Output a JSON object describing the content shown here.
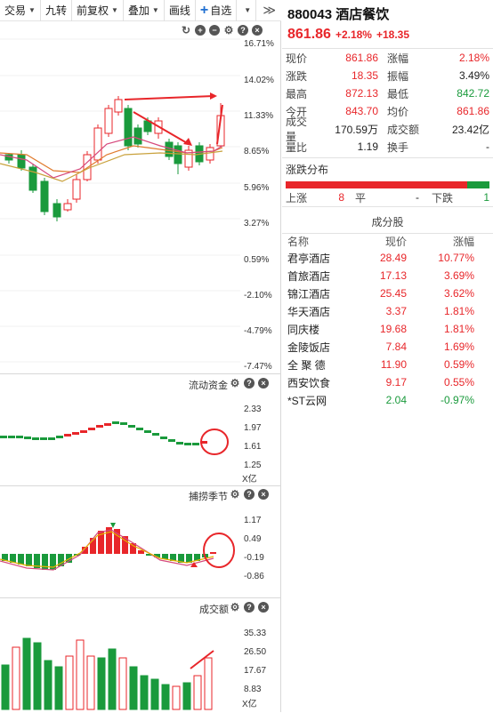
{
  "toolbar": {
    "trade": "交易",
    "nine_turn": "九转",
    "adjust": "前复权",
    "overlay": "叠加",
    "draw": "画线",
    "watchlist": "自选",
    "more": "≫"
  },
  "main_chart": {
    "price_labels": [
      "16.71%",
      "14.02%",
      "11.33%",
      "8.65%",
      "5.96%",
      "3.27%",
      "0.59%",
      "-2.10%",
      "-4.79%",
      "-7.47%"
    ]
  },
  "fund_flow": {
    "title": "流动资金",
    "axis_labels": [
      "2.33",
      "1.97",
      "1.61",
      "1.25"
    ],
    "unit": "X亿"
  },
  "catch_season": {
    "title": "捕捞季节",
    "axis_labels": [
      "1.17",
      "0.49",
      "-0.19",
      "-0.86"
    ]
  },
  "volume": {
    "title": "成交额",
    "axis_labels": [
      "35.33",
      "26.50",
      "17.67",
      "8.83"
    ],
    "unit": "X亿"
  },
  "stock": {
    "code_name": "880043 酒店餐饮",
    "price": "861.86",
    "change_pct": "+2.18%",
    "change": "+18.35"
  },
  "quote": [
    {
      "k": "现价",
      "v": "861.86",
      "vc": "red",
      "k2": "涨幅",
      "v2": "2.18%",
      "v2c": "red"
    },
    {
      "k": "涨跌",
      "v": "18.35",
      "vc": "red",
      "k2": "振幅",
      "v2": "3.49%",
      "v2c": "dark"
    },
    {
      "k": "最高",
      "v": "872.13",
      "vc": "red",
      "k2": "最低",
      "v2": "842.72",
      "v2c": "green"
    },
    {
      "k": "今开",
      "v": "843.70",
      "vc": "red",
      "k2": "均价",
      "v2": "861.86",
      "v2c": "red"
    },
    {
      "k": "成交量",
      "v": "170.59万",
      "vc": "dark",
      "k2": "成交额",
      "v2": "23.42亿",
      "v2c": "dark"
    },
    {
      "k": "量比",
      "v": "1.19",
      "vc": "dark",
      "k2": "换手",
      "v2": "-",
      "v2c": "dark"
    }
  ],
  "distribution": {
    "title": "涨跌分布",
    "up_label": "上涨",
    "up_count": "8",
    "flat_label": "平",
    "flat_count": "-",
    "down_label": "下跌",
    "down_count": "1",
    "up_share": 0.889
  },
  "components": {
    "title": "成分股",
    "col_name": "名称",
    "col_price": "现价",
    "col_pct": "涨幅",
    "rows": [
      {
        "name": "君亭酒店",
        "price": "28.49",
        "pct": "10.77%",
        "c": "red"
      },
      {
        "name": "首旅酒店",
        "price": "17.13",
        "pct": "3.69%",
        "c": "red"
      },
      {
        "name": "锦江酒店",
        "price": "25.45",
        "pct": "3.62%",
        "c": "red"
      },
      {
        "name": "华天酒店",
        "price": "3.37",
        "pct": "1.81%",
        "c": "red"
      },
      {
        "name": "同庆楼",
        "price": "19.68",
        "pct": "1.81%",
        "c": "red"
      },
      {
        "name": "金陵饭店",
        "price": "7.84",
        "pct": "1.69%",
        "c": "red"
      },
      {
        "name": "全 聚 德",
        "price": "11.90",
        "pct": "0.59%",
        "c": "red"
      },
      {
        "name": "西安饮食",
        "price": "9.17",
        "pct": "0.55%",
        "c": "red"
      },
      {
        "name": "*ST云网",
        "price": "2.04",
        "pct": "-0.97%",
        "c": "green"
      }
    ]
  }
}
